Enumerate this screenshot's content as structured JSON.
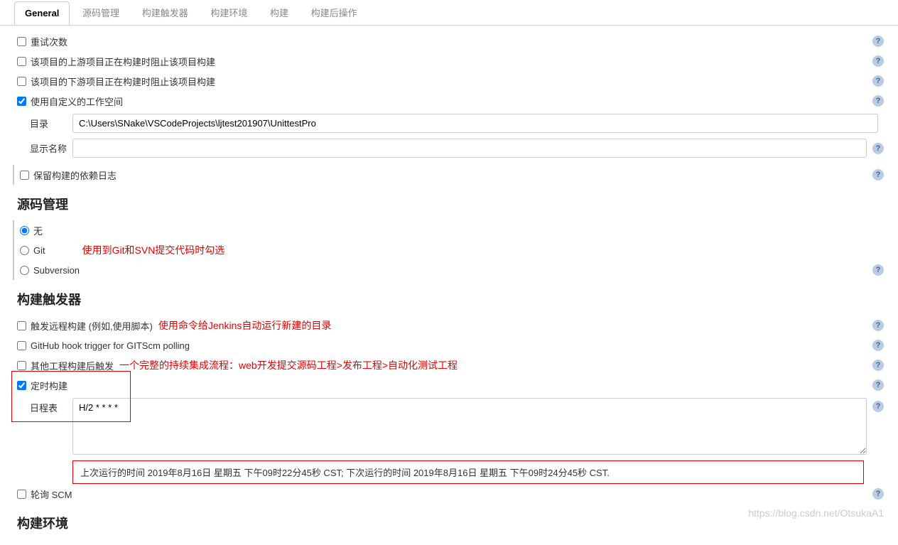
{
  "tabs": [
    {
      "label": "General",
      "active": true
    },
    {
      "label": "源码管理"
    },
    {
      "label": "构建触发器"
    },
    {
      "label": "构建环境"
    },
    {
      "label": "构建"
    },
    {
      "label": "构建后操作"
    }
  ],
  "general": {
    "retry_count": "重试次数",
    "block_upstream": "该项目的上游项目正在构建时阻止该项目构建",
    "block_downstream": "该项目的下游项目正在构建时阻止该项目构建",
    "custom_workspace": "使用自定义的工作空间",
    "directory_label": "目录",
    "directory_value": "C:\\Users\\SNake\\VSCodeProjects\\ljtest201907\\UnittestPro",
    "display_name_label": "显示名称",
    "display_name_value": "",
    "keep_deps_log": "保留构建的依赖日志"
  },
  "scm": {
    "header": "源码管理",
    "none": "无",
    "git": "Git",
    "subversion": "Subversion",
    "annotation": "使用到Git和SVN提交代码时勾选"
  },
  "triggers": {
    "header": "构建触发器",
    "remote": "触发远程构建 (例如,使用脚本)",
    "remote_annotation": "使用命令给Jenkins自动运行新建的目录",
    "github_hook": "GitHub hook trigger for GITScm polling",
    "after_others": "其他工程构建后触发",
    "after_others_annotation": "一个完整的持续集成流程：web开发提交源码工程>发布工程>自动化测试工程",
    "timer": "定时构建",
    "schedule_label": "日程表",
    "schedule_value": "H/2 * * * *",
    "schedule_info": "上次运行的时间 2019年8月16日 星期五 下午09时22分45秒 CST; 下次运行的时间 2019年8月16日 星期五 下午09时24分45秒 CST.",
    "poll_scm": "轮询 SCM"
  },
  "env": {
    "header": "构建环境"
  },
  "help_symbol": "?",
  "watermark": "https://blog.csdn.net/OtsukaA1"
}
